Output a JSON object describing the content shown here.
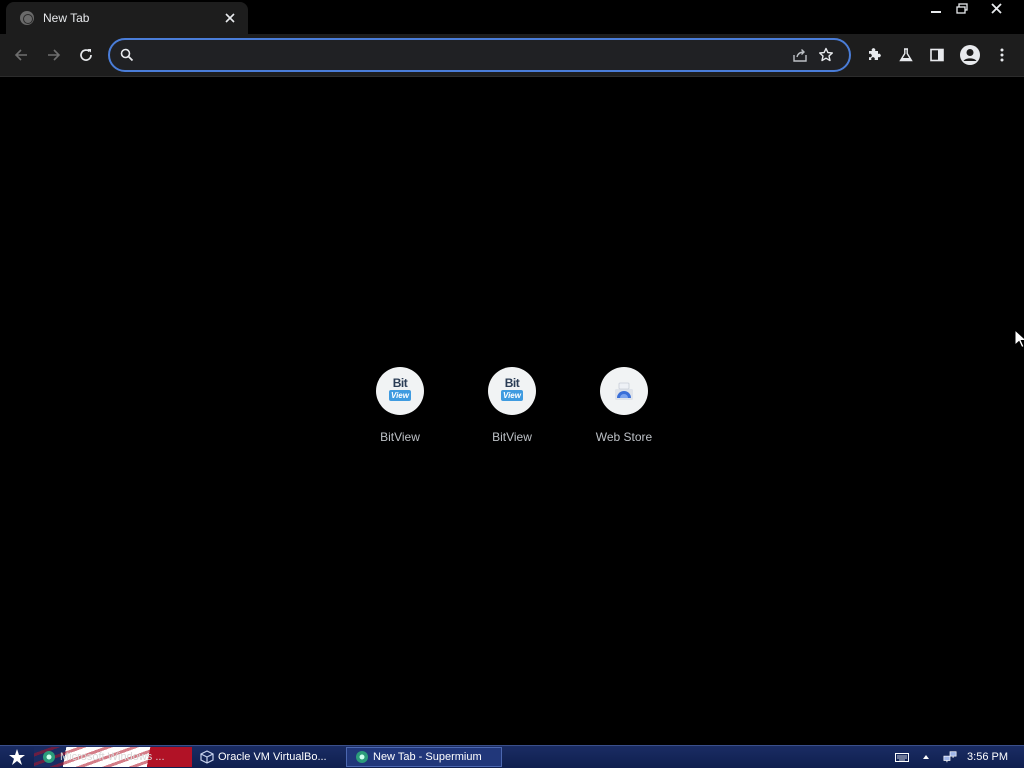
{
  "tab": {
    "title": "New Tab"
  },
  "omnibox": {
    "value": "",
    "placeholder": ""
  },
  "shortcuts": [
    {
      "label": "BitView",
      "logo_top": "Bit",
      "logo_bottom": "View"
    },
    {
      "label": "BitView",
      "logo_top": "Bit",
      "logo_bottom": "View"
    },
    {
      "label": "Web Store"
    }
  ],
  "taskbar": {
    "items": [
      {
        "label": "Microsoft Windows ..."
      },
      {
        "label": "Oracle VM VirtualBo..."
      },
      {
        "label": "New Tab - Supermium"
      }
    ],
    "clock": "3:56 PM"
  },
  "colors": {
    "page_background": "#000000",
    "toolbar": "#1d1d1d",
    "omnibox_focus_ring": "#4a7dd8",
    "taskbar": "#1a2c63"
  },
  "icons": [
    "globe-icon",
    "close-icon",
    "minimize-icon",
    "restore-icon",
    "back-icon",
    "forward-icon",
    "reload-icon",
    "search-icon",
    "share-icon",
    "star-icon",
    "extensions-icon",
    "labs-icon",
    "side-panel-icon",
    "profile-icon",
    "more-icon"
  ]
}
